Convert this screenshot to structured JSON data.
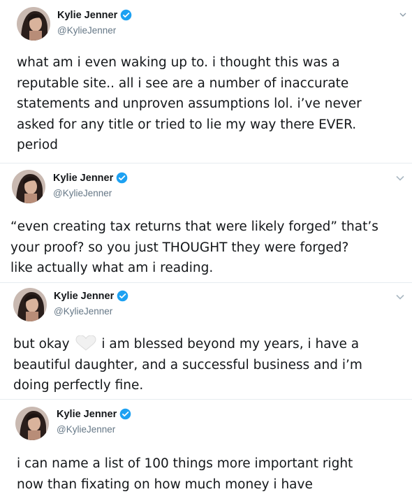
{
  "tweets": [
    {
      "author": {
        "name": "Kylie Jenner",
        "handle": "@KylieJenner",
        "verified": true
      },
      "text": "what am i even waking up to. i thought this was a\nreputable site.. all i see are a number of inaccurate\nstatements and unproven assumptions lol. i’ve never\nasked for any title or tried to lie my way there EVER.\nperiod"
    },
    {
      "author": {
        "name": "Kylie Jenner",
        "handle": "@KylieJenner",
        "verified": true
      },
      "text": "“even creating tax returns that were likely forged” that’s\nyour proof? so you just THOUGHT they were forged?\nlike actually what am i reading."
    },
    {
      "author": {
        "name": "Kylie Jenner",
        "handle": "@KylieJenner",
        "verified": true
      },
      "text_before_emoji": "but okay",
      "emoji": "white-heart",
      "text_after_emoji": " i am blessed beyond my years, i have a\nbeautiful daughter, and a successful business and i’m\ndoing perfectly fine."
    },
    {
      "author": {
        "name": "Kylie Jenner",
        "handle": "@KylieJenner",
        "verified": true
      },
      "text": "i can name a list of 100 things more important right\nnow than fixating on how much money i have"
    }
  ],
  "colors": {
    "name": "#14171a",
    "handle": "#657786",
    "verified_badge": "#1da1f2",
    "divider": "#e6ecf0",
    "chevron": "#aab8c2"
  },
  "icons": {
    "verified": "verified-badge-icon",
    "menu": "chevron-down-icon",
    "emoji": "white-heart-icon"
  }
}
